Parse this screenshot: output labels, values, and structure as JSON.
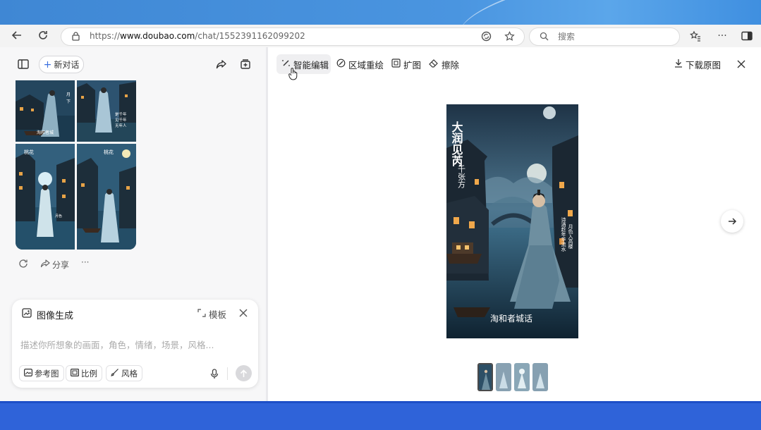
{
  "browser": {
    "url_prefix": "https://",
    "url_host": "www.doubao.com",
    "url_path": "/chat/1552391162099202",
    "search_placeholder": "搜索"
  },
  "sidebar": {
    "new_chat_label": "新对话",
    "share_label": "分享",
    "more_label": "···"
  },
  "image_panel": {
    "title": "图像生成",
    "template_label": "模板",
    "prompt_placeholder": "描述你所想象的画面，角色，情绪，场景，风格...",
    "chips": [
      "参考图",
      "比例",
      "风格"
    ]
  },
  "viewer": {
    "tools": [
      "智能编辑",
      "区域重绘",
      "扩图",
      "擦除"
    ],
    "download_label": "下载原图",
    "poster_title_right": "大润见芮",
    "poster_title_left": "千张方",
    "poster_bottom": "淘和者城话",
    "thumbnail_count": 4,
    "selected_thumbnail": 1
  },
  "colors": {
    "accent_blue": "#2f63d9",
    "night_sky": "#3b5e78",
    "robe": "#6e8fa0"
  }
}
